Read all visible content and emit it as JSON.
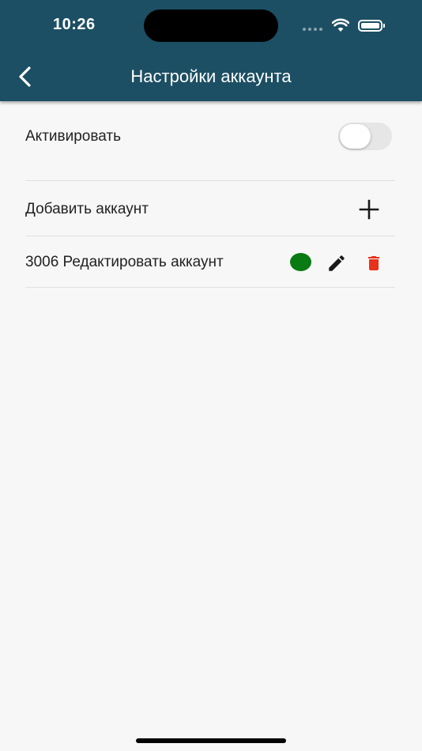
{
  "status_bar": {
    "time": "10:26"
  },
  "header": {
    "title": "Настройки аккаунта",
    "back_icon": "chevron-left-icon"
  },
  "activate": {
    "label": "Активировать",
    "enabled": false
  },
  "add_account": {
    "label": "Добавить аккаунт",
    "icon": "plus-icon"
  },
  "accounts": [
    {
      "label": "3006 Редактировать аккаунт",
      "status_color": "#0a7a12",
      "edit_icon": "pencil-icon",
      "delete_icon": "trash-icon",
      "delete_color": "#e8321a"
    }
  ],
  "colors": {
    "header": "#1c4f63",
    "background": "#f7f7f7"
  }
}
